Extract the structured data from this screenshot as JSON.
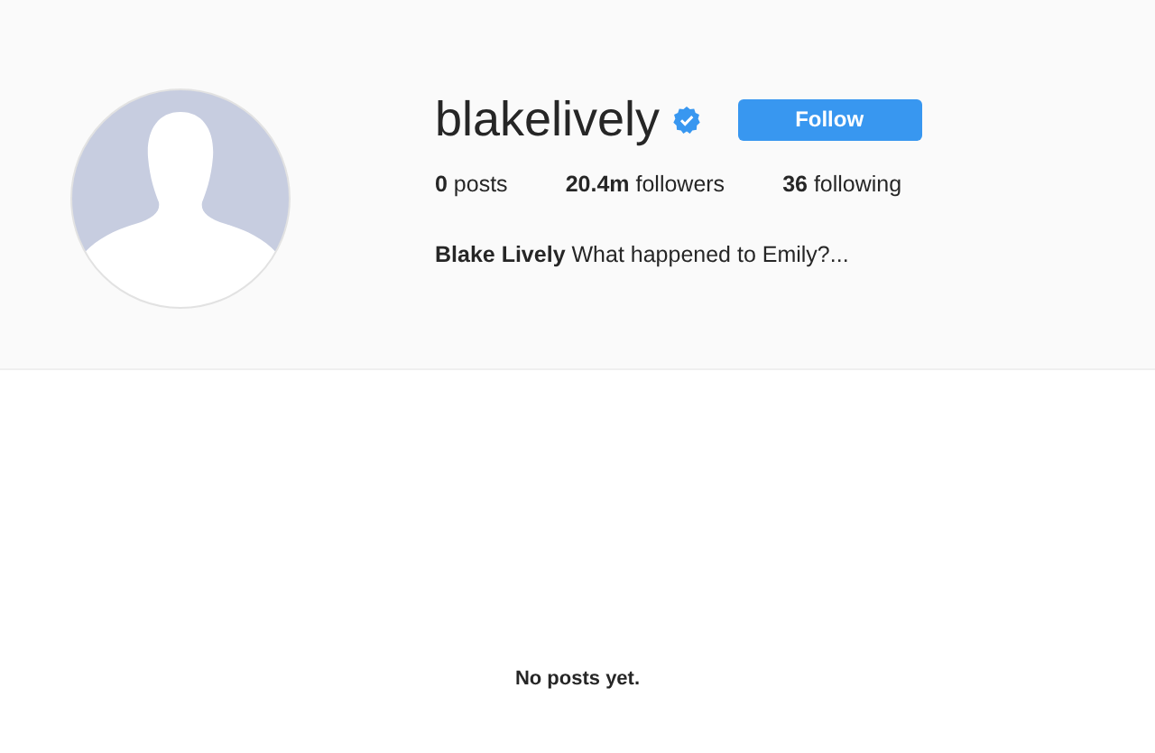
{
  "profile": {
    "username": "blakelively",
    "verified": true,
    "follow_button": "Follow",
    "stats": [
      "**0** posts",
      "**20.4m** followers",
      "**36** following"
    ],
    "bio": "**Blake Lively** What happened to Emily?..."
  },
  "empty_message": "No posts yet."
}
